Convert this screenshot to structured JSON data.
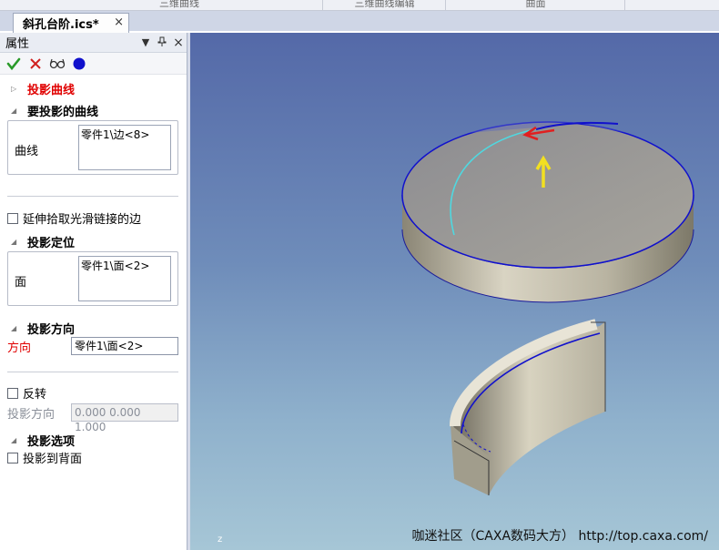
{
  "ribbon": {
    "segments": [
      "三维曲线",
      "三维曲线编辑",
      "曲面"
    ]
  },
  "tab": {
    "title": "斜孔台阶.ics*",
    "close_glyph": "×"
  },
  "panel": {
    "title": "属性",
    "controls": {
      "dropdown": "▼",
      "pin": "ꟷ",
      "close": "×"
    },
    "toolbar": {
      "ok_icon": "check-icon",
      "cancel_icon": "cross-icon",
      "preview_icon": "glasses-icon",
      "status_icon": "blue-circle-icon",
      "ok_color": "#2a9a2a",
      "cancel_color": "#d02020",
      "status_color": "#1010cc"
    },
    "sections": {
      "projection_curve": {
        "label": "投影曲线",
        "tri": "▷"
      },
      "curve_to_project": {
        "label": "要投影的曲线",
        "tri": "◢",
        "field_label": "曲线",
        "list_value": "零件1\\边<8>"
      },
      "extend": {
        "label": "延伸拾取光滑链接的边"
      },
      "projection_position": {
        "label": "投影定位",
        "tri": "◢",
        "field_label": "面",
        "list_value": "零件1\\面<2>"
      },
      "projection_direction": {
        "label": "投影方向",
        "tri": "◢",
        "field_label": "方向",
        "field_value": "零件1\\面<2>"
      },
      "reverse": {
        "label": "反转",
        "dir_label": "投影方向",
        "dir_value": "0.000  0.000  1.000"
      },
      "options": {
        "label": "投影选项",
        "tri": "◢",
        "backface_label": "投影到背面"
      }
    }
  },
  "viewport": {
    "watermark": "咖迷社区（CAXA数码大方） http://top.caxa.com/",
    "axis_label": "z"
  }
}
